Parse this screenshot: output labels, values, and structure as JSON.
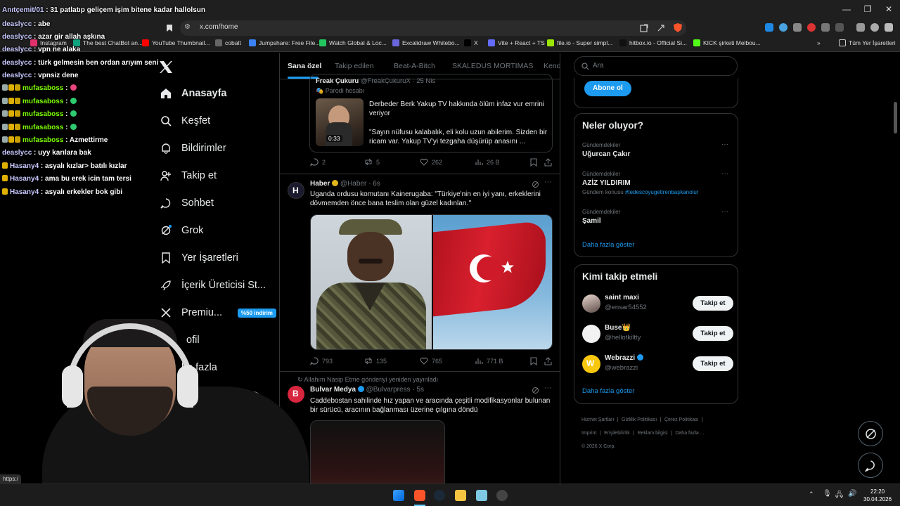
{
  "browser": {
    "url": "x.com/home",
    "bookmarks": [
      "Instagram",
      "The best ChatBot an...",
      "YouTube Thumbnail...",
      "cobalt",
      "Jumpshare: Free File...",
      "Watch Global & Loc...",
      "Excalidraw Whitebo...",
      "X",
      "Vite + React + TS",
      "file.io - Super simpl...",
      "hitbox.io - Official Si...",
      "KICK şirketi Melbou..."
    ],
    "bookmarks_more": "»",
    "all_bookmarks": "Tüm Yer İşaretleri",
    "status_url": "https:/"
  },
  "chat": [
    {
      "user": "Anıtçemit/01",
      "msg": ": 31 patlatıp geliçem işim bitene kadar hallolsun",
      "user_color": "#c8c8ff"
    },
    {
      "user": "deaslycc",
      "msg": ": abe",
      "user_color": "#c8c8ff"
    },
    {
      "user": "deaslycc",
      "msg": ": azar gir allah aşkına",
      "user_color": "#c8c8ff"
    },
    {
      "user": "deaslycc",
      "msg": ": vpn ne alaka",
      "user_color": "#c8c8ff"
    },
    {
      "user": "deaslycc",
      "msg": ": türk gelmesin ben ordan arıyım seni",
      "user_color": "#c8c8ff"
    },
    {
      "user": "deaslycc",
      "msg": ": vpnsiz dene",
      "user_color": "#c8c8ff"
    },
    {
      "user": "mufasaboss",
      "msg": ":",
      "user_color": "#7cfc00",
      "badges": true
    },
    {
      "user": "mufasaboss",
      "msg": ":",
      "user_color": "#7cfc00",
      "badges": true
    },
    {
      "user": "mufasaboss",
      "msg": ":",
      "user_color": "#7cfc00",
      "badges": true
    },
    {
      "user": "mufasaboss",
      "msg": ":",
      "user_color": "#7cfc00",
      "badges": true
    },
    {
      "user": "mufasaboss",
      "msg": ": Azmettirme",
      "user_color": "#7cfc00",
      "badges": true
    },
    {
      "user": "deaslycc",
      "msg": ": uyy karılara bak",
      "user_color": "#c8c8ff"
    },
    {
      "user": "Hasany4",
      "msg": ": asyalı kızlar> batılı kızlar",
      "user_color": "#c8c8ff",
      "badge1": true
    },
    {
      "user": "Hasany4",
      "msg": ": ama bu erek icin tam tersi",
      "user_color": "#c8c8ff",
      "badge1": true
    },
    {
      "user": "Hasany4",
      "msg": ": asyalı erkekler bok gibi",
      "user_color": "#c8c8ff",
      "badge1": true
    }
  ],
  "nav": {
    "home": "Anasayfa",
    "explore": "Keşfet",
    "notifications": "Bildirimler",
    "follow": "Takip et",
    "chat": "Sohbet",
    "grok": "Grok",
    "bookmarks": "Yer İşaretleri",
    "creator": "İçerik Üreticisi St...",
    "premium": "Premiu...",
    "premium_badge": "%50 indirim",
    "profile": "ofil",
    "more": "ha fazla"
  },
  "tabs": [
    "Sana özel",
    "Takip edilen",
    "Beat-A-Bitch",
    "SKALEDUS MORTIMAS",
    "Kend"
  ],
  "tweets": {
    "t1": {
      "quoted_name": "Freak Çukuru",
      "quoted_handle": "@FreakÇukuruX · 25 Nis",
      "parody": "Parodi hesabı",
      "quoted_text1": "Derbeder Berk Yakup TV hakkında ölüm infaz vur emrini veriyor",
      "quoted_text2": "\"Sayın nüfusu kalabalık, eli kolu uzun abilerim. Sizden bir ricam var. Yakup TV'yi tezgaha düşürüp anasını ...",
      "video_time": "0:33",
      "replies": "2",
      "retweets": "5",
      "likes": "262",
      "views": "26 B"
    },
    "t2": {
      "name": "Haber",
      "handle": "@Haber · 6s",
      "text": "Uganda ordusu komutanı Kainerugaba: \"Türkiye'nin en iyi yanı, erkeklerini dövmemden önce bana teslim olan güzel kadınları.\"",
      "replies": "793",
      "retweets": "135",
      "likes": "765",
      "views": "771 B"
    },
    "t3": {
      "repost": "Allahım Nasip Etme gönderiyi yeniden yayınladı",
      "name": "Bulvar Medya",
      "handle": "@Bulvarpress · 5s",
      "text": "Caddebostan sahilinde hız yapan ve aracında çeşitli modifikasyonlar bulunan bir sürücü, aracının bağlanması üzerine çılgına döndü"
    }
  },
  "right": {
    "search_placeholder": "Ara",
    "subscribe": "Abone ol",
    "trends_title": "Neler oluyor?",
    "trends": [
      {
        "ctx": "Gündemdekiler",
        "name": "Uğurcan Çakır",
        "sub": ""
      },
      {
        "ctx": "Gündemdekiler",
        "name": "AZİZ YILDIRIM",
        "sub_label": "Gündem konusu",
        "sub": "#tedescoyugetirenbaşkanolur"
      },
      {
        "ctx": "Gündemdekiler",
        "name": "Şamil",
        "sub": ""
      }
    ],
    "show_more": "Daha fazla göster",
    "who_title": "Kimi takip etmeli",
    "who": [
      {
        "name": "saint maxi",
        "handle": "@ensar54552",
        "btn": "Takip et"
      },
      {
        "name": "Buse👑",
        "handle": "@hellotkiltty",
        "btn": "Takip et"
      },
      {
        "name": "Webrazzi",
        "handle": "@webrazzi",
        "btn": "Takip et"
      }
    ],
    "footer": [
      "Hizmet Şartları",
      "|",
      "Gizlilik Politikası",
      "|",
      "Çerez Politikası",
      "|",
      "Imprint",
      "|",
      "Erişilebilirlik",
      "|",
      "Reklam bilgisi",
      "|",
      "Daha fazla ...",
      "© 2026 X Corp."
    ]
  },
  "taskbar": {
    "time": "22:20",
    "date": "30.04.2026"
  },
  "colors": {
    "accent": "#1d9bf0",
    "bg": "#000000",
    "border": "#2f3336",
    "muted": "#71767b"
  }
}
